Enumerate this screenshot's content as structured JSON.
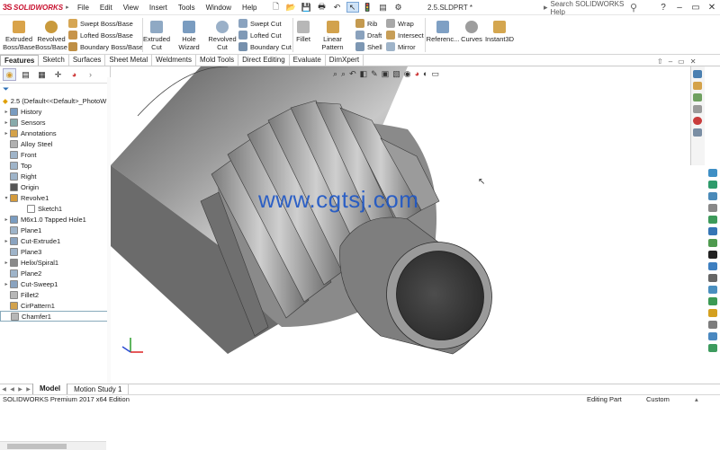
{
  "app": {
    "logo_ds": "3S",
    "logo_name": "SOLIDWORKS",
    "document_title": "2.5.SLDPRT *",
    "help_placeholder": "Search SOLIDWORKS Help",
    "window_controls": [
      "restore-icon",
      "minimize-icon",
      "maximize-icon",
      "close-icon"
    ]
  },
  "menus": [
    "File",
    "Edit",
    "View",
    "Insert",
    "Tools",
    "Window",
    "Help"
  ],
  "ribbon": {
    "extruded_boss": "Extruded Boss/Base",
    "revolved_boss": "Revolved Boss/Base",
    "swept_boss": "Swept Boss/Base",
    "lofted_boss": "Lofted Boss/Base",
    "boundary_boss": "Boundary Boss/Base",
    "extruded_cut": "Extruded Cut",
    "hole_wizard": "Hole Wizard",
    "revolved_cut": "Revolved Cut",
    "swept_cut": "Swept Cut",
    "lofted_cut": "Lofted Cut",
    "boundary_cut": "Boundary Cut",
    "fillet": "Fillet",
    "linear_pattern": "Linear Pattern",
    "rib": "Rib",
    "draft": "Draft",
    "shell": "Shell",
    "wrap": "Wrap",
    "intersect": "Intersect",
    "mirror": "Mirror",
    "reference": "Referenc...",
    "curves": "Curves",
    "instant3d": "Instant3D"
  },
  "cmd_tabs": [
    "Features",
    "Sketch",
    "Surfaces",
    "Sheet Metal",
    "Weldments",
    "Mold Tools",
    "Direct Editing",
    "Evaluate",
    "DimXpert"
  ],
  "tree": {
    "root": "2.5  (Default<<Default>_PhotoW",
    "items": [
      {
        "label": "History",
        "icon": "history-icon"
      },
      {
        "label": "Sensors",
        "icon": "sensor-icon"
      },
      {
        "label": "Annotations",
        "icon": "annotation-icon"
      },
      {
        "label": "Alloy Steel",
        "icon": "material-icon"
      },
      {
        "label": "Front",
        "icon": "plane-icon"
      },
      {
        "label": "Top",
        "icon": "plane-icon"
      },
      {
        "label": "Right",
        "icon": "plane-icon"
      },
      {
        "label": "Origin",
        "icon": "origin-icon"
      },
      {
        "label": "Revolve1",
        "icon": "revolve-icon"
      },
      {
        "label": "Sketch1",
        "icon": "sketch-icon"
      },
      {
        "label": "M6x1.0 Tapped Hole1",
        "icon": "hole-icon"
      },
      {
        "label": "Plane1",
        "icon": "plane-icon"
      },
      {
        "label": "Cut-Extrude1",
        "icon": "cut-icon"
      },
      {
        "label": "Plane3",
        "icon": "plane-icon"
      },
      {
        "label": "Helix/Spiral1",
        "icon": "helix-icon"
      },
      {
        "label": "Plane2",
        "icon": "plane-icon"
      },
      {
        "label": "Cut-Sweep1",
        "icon": "cut-icon"
      },
      {
        "label": "Fillet2",
        "icon": "fillet-icon"
      },
      {
        "label": "CirPattern1",
        "icon": "pattern-icon"
      },
      {
        "label": "Chamfer1",
        "icon": "chamfer-icon"
      }
    ]
  },
  "watermark": "www.cgtsj.com",
  "bottom_tabs": [
    "Model",
    "Motion Study 1"
  ],
  "status": {
    "left": "SOLIDWORKS Premium 2017 x64 Edition",
    "mode": "Editing Part",
    "units": "Custom"
  },
  "colors": {
    "accent": "#c8102e",
    "selection": "#cfe3f7",
    "watermark": "#1d56c6"
  }
}
